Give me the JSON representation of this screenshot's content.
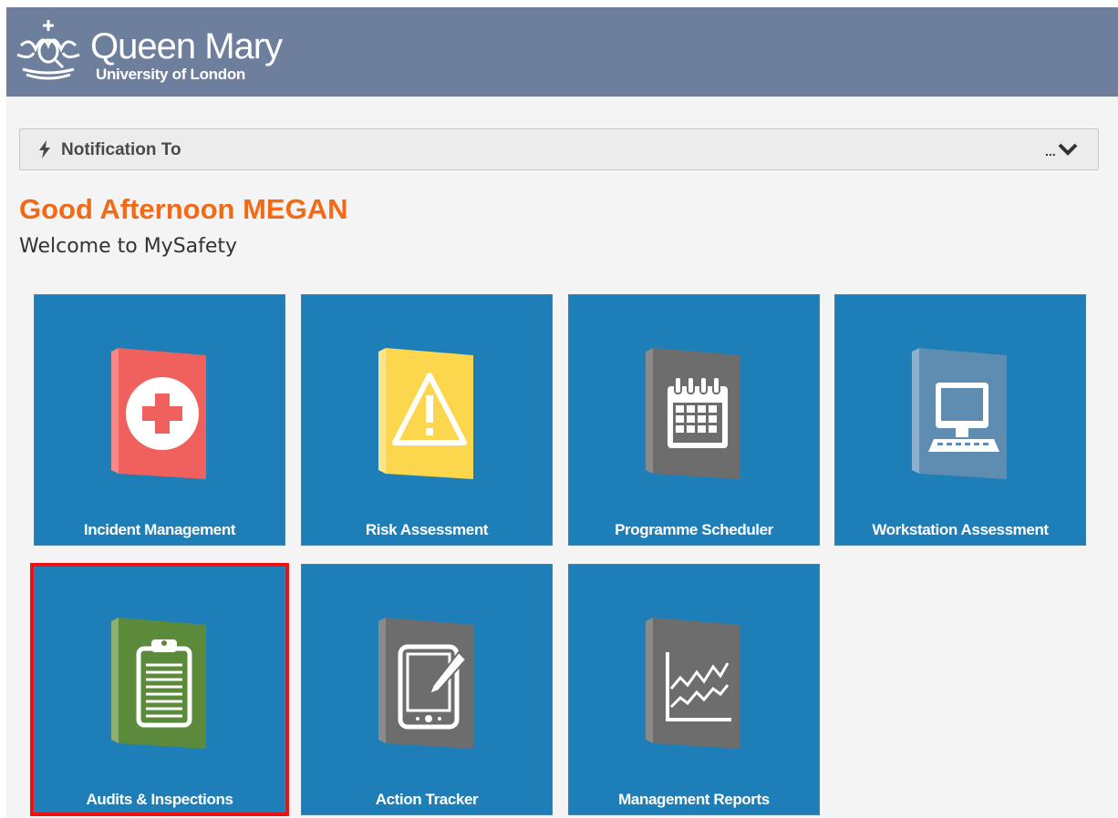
{
  "header": {
    "logo_name": "Queen Mary",
    "logo_sub": "University of London",
    "bg_color": "#6e7f9e"
  },
  "notification": {
    "title": "Notification To",
    "bolt_icon": "bolt-icon",
    "more": "...",
    "chevron_icon": "chevron-down-icon"
  },
  "greeting": {
    "title": "Good Afternoon MEGAN",
    "subtitle": "Welcome to MySafety",
    "title_color": "#f26a16"
  },
  "tiles": [
    {
      "label": "Incident Management",
      "icon": "first-aid-icon",
      "color": "#f0605d"
    },
    {
      "label": "Risk Assessment",
      "icon": "warning-icon",
      "color": "#fcd64d"
    },
    {
      "label": "Programme Scheduler",
      "icon": "calendar-icon",
      "color": "#6d6d6d"
    },
    {
      "label": "Workstation Assessment",
      "icon": "computer-icon",
      "color": "#5f8db1"
    },
    {
      "label": "Audits & Inspections",
      "icon": "clipboard-icon",
      "color": "#5a8a3a",
      "highlighted": true
    },
    {
      "label": "Action Tracker",
      "icon": "tablet-pen-icon",
      "color": "#6d6d6d"
    },
    {
      "label": "Management Reports",
      "icon": "line-chart-icon",
      "color": "#6d6d6d"
    }
  ],
  "tile_color": "#1e7fb8",
  "highlight_color": "#ee1111"
}
